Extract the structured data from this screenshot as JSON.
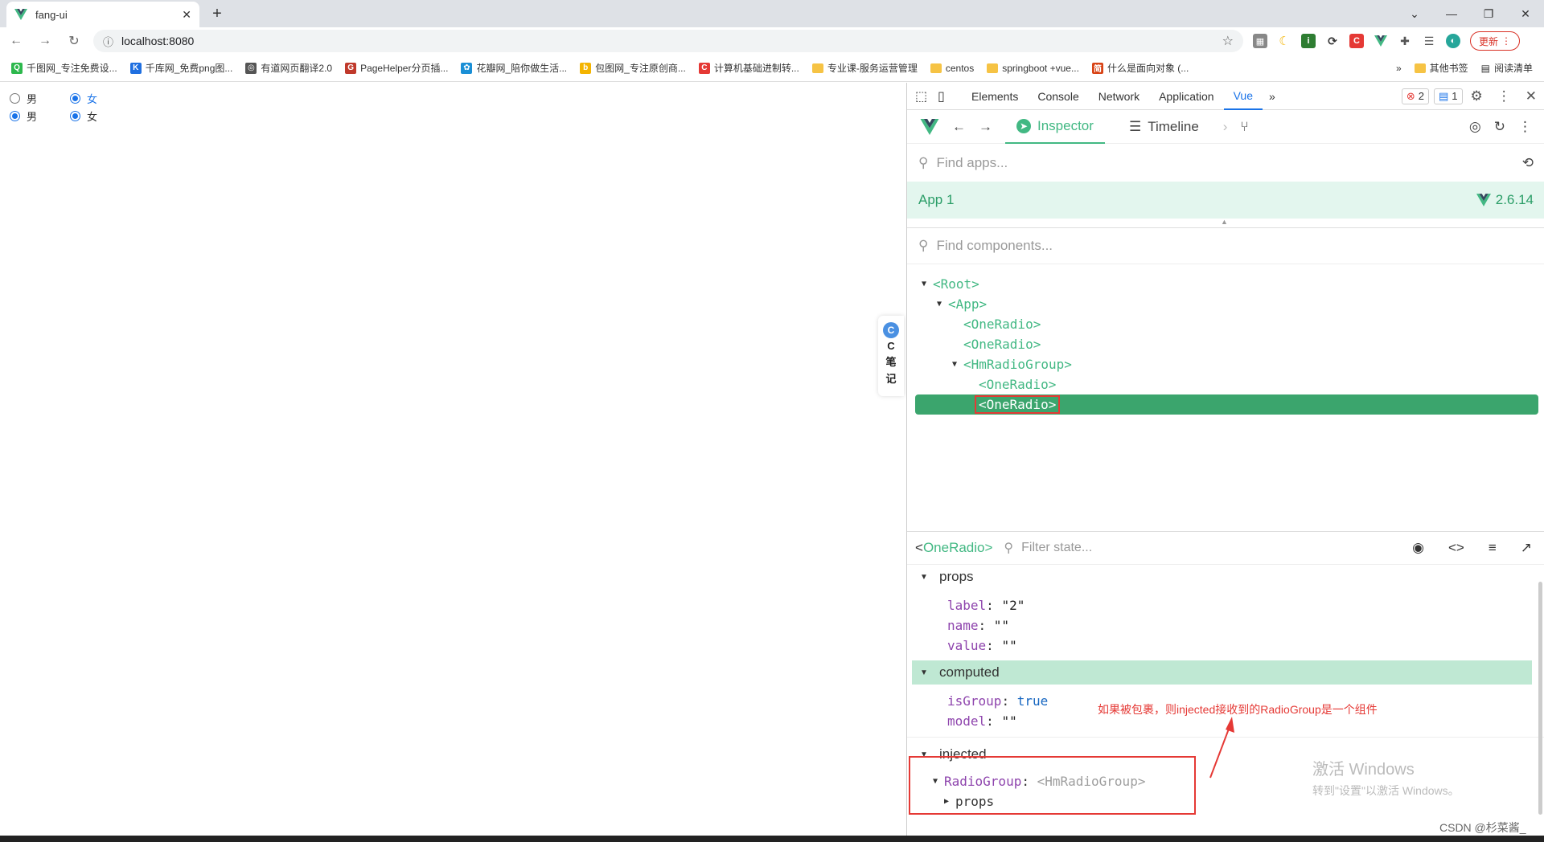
{
  "browser": {
    "tab_title": "fang-ui",
    "url": "localhost:8080",
    "update_label": "更新"
  },
  "bookmarks": [
    {
      "label": "千图网_专注免费设...",
      "color": "#2db84d",
      "glyph": "Q"
    },
    {
      "label": "千库网_免费png图...",
      "color": "#1f6fe0",
      "glyph": "K"
    },
    {
      "label": "有道网页翻译2.0",
      "color": "#555555",
      "glyph": "◎"
    },
    {
      "label": "PageHelper分页插...",
      "color": "#c0392b",
      "glyph": "G"
    },
    {
      "label": "花瓣网_陪你做生活...",
      "color": "#1a8fd6",
      "glyph": "✿"
    },
    {
      "label": "包图网_专注原创商...",
      "color": "#f4b400",
      "glyph": "b"
    },
    {
      "label": "计算机基础进制转...",
      "color": "#e53935",
      "glyph": "C"
    },
    {
      "label": "专业课-服务运营管理",
      "folder": true
    },
    {
      "label": "centos",
      "folder": true
    },
    {
      "label": "springboot +vue...",
      "folder": true
    },
    {
      "label": "什么是面向对象 (...",
      "color": "#d84315",
      "glyph": "简"
    }
  ],
  "bookmarks_right": {
    "more": "»",
    "other": "其他书签",
    "reading": "阅读清单"
  },
  "page": {
    "rows": [
      {
        "opt1": "男",
        "opt1_checked": false,
        "opt2": "女",
        "opt2_checked": true
      },
      {
        "opt1": "男",
        "opt1_checked": true,
        "opt2": "女",
        "opt2_checked": true
      }
    ],
    "note_logo": "C",
    "note_text": [
      "C",
      "笔",
      "记"
    ]
  },
  "devtools": {
    "tabs": [
      "Elements",
      "Console",
      "Network",
      "Application",
      "Vue"
    ],
    "active_tab": "Vue",
    "more_tabs": "»",
    "errors": "2",
    "messages": "1",
    "vue_tabs": {
      "inspector": "Inspector",
      "timeline": "Timeline"
    },
    "find_apps_placeholder": "Find apps...",
    "app_name": "App 1",
    "vue_version": "2.6.14",
    "find_components_placeholder": "Find components...",
    "tree": [
      {
        "label": "<Root>",
        "arrow": "▼",
        "depth": 0
      },
      {
        "label": "<App>",
        "arrow": "▼",
        "depth": 1
      },
      {
        "label": "<OneRadio>",
        "arrow": "",
        "depth": 2
      },
      {
        "label": "<OneRadio>",
        "arrow": "",
        "depth": 2
      },
      {
        "label": "<HmRadioGroup>",
        "arrow": "▼",
        "depth": 2
      },
      {
        "label": "<OneRadio>",
        "arrow": "",
        "depth": 3
      },
      {
        "label": "<OneRadio>",
        "arrow": "",
        "depth": 3,
        "selected": true
      }
    ],
    "selected_component": "<OneRadio>",
    "filter_state_placeholder": "Filter state...",
    "state": {
      "props_label": "props",
      "props": [
        {
          "k": "label",
          "v": "\"2\""
        },
        {
          "k": "name",
          "v": "\"\""
        },
        {
          "k": "value",
          "v": "\"\""
        }
      ],
      "computed_label": "computed",
      "computed": [
        {
          "k": "isGroup",
          "v": "true",
          "kw": true
        },
        {
          "k": "model",
          "v": "\"\""
        }
      ],
      "injected_label": "injected",
      "injected_key": "RadioGroup",
      "injected_val": "<HmRadioGroup>",
      "sub_props": "props"
    }
  },
  "annotation": "如果被包裹，则injected接收到的RadioGroup是一个组件",
  "watermark": {
    "title": "激活 Windows",
    "sub": "转到\"设置\"以激活 Windows。"
  },
  "csdn": "CSDN @杉菜酱_"
}
